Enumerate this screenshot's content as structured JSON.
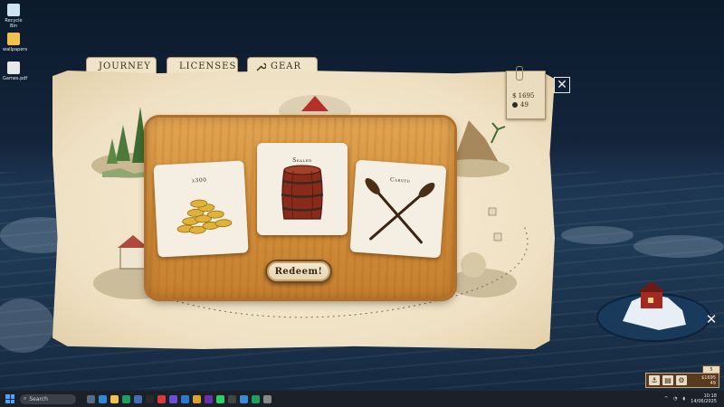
{
  "desktop": {
    "icons": [
      {
        "label": "Recycle Bin",
        "icon": "recycle-bin-icon",
        "color": "#cfe3f5"
      },
      {
        "label": "wallpapers",
        "icon": "folder-icon",
        "color": "#f2c14e"
      },
      {
        "label": "Games.pdf",
        "icon": "pdf-icon",
        "color": "#e8e8e8"
      }
    ]
  },
  "tabs": [
    {
      "label": "JOURNEY",
      "icon": "compass-icon"
    },
    {
      "label": "LICENSES",
      "icon": "hook-icon"
    },
    {
      "label": "GEAR",
      "icon": "wrench-icon"
    }
  ],
  "wallet": {
    "money": "$ 1695",
    "coins": "49"
  },
  "close_symbol": "✕",
  "rewards": [
    {
      "caption": "x300",
      "item": "gold-coins"
    },
    {
      "caption": "Sealed",
      "item": "barrel"
    },
    {
      "caption": "Carved",
      "item": "oars"
    }
  ],
  "redeem_label": "Redeem!",
  "hud": {
    "money": "$1695",
    "coins": "49",
    "flag": "5"
  },
  "taskbar": {
    "search_placeholder": "Search",
    "time": "10:18",
    "date": "14/06/2025"
  },
  "colors": {
    "board": "#d38f3b",
    "parchment": "#f1e4c8",
    "accent_red": "#b5302a"
  }
}
